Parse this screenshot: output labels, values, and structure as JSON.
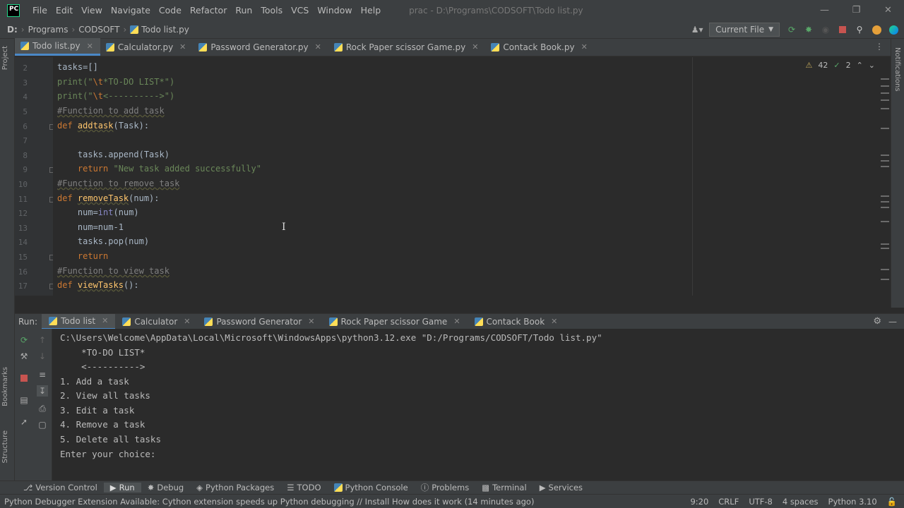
{
  "app": {
    "logo": "PC",
    "window_title": "prac - D:\\Programs\\CODSOFT\\Todo list.py"
  },
  "menu": [
    "File",
    "Edit",
    "View",
    "Navigate",
    "Code",
    "Refactor",
    "Run",
    "Tools",
    "VCS",
    "Window",
    "Help"
  ],
  "breadcrumb": [
    "D:",
    "Programs",
    "CODSOFT",
    "Todo list.py"
  ],
  "run_config": "Current File",
  "editor_tabs": [
    "Todo list.py",
    "Calculator.py",
    "Password Generator.py",
    "Rock Paper scissor Game.py",
    "Contack Book.py"
  ],
  "inspections": {
    "warnings": "42",
    "weak_warnings": "2"
  },
  "side_labels": {
    "project": "Project",
    "notifications": "Notifications",
    "bookmarks": "Bookmarks",
    "structure": "Structure"
  },
  "code_lines": [
    {
      "num": "2"
    },
    {
      "num": "3"
    },
    {
      "num": "4"
    },
    {
      "num": "5"
    },
    {
      "num": "6"
    },
    {
      "num": "7"
    },
    {
      "num": "8"
    },
    {
      "num": "9"
    },
    {
      "num": "10"
    },
    {
      "num": "11"
    },
    {
      "num": "12"
    },
    {
      "num": "13"
    },
    {
      "num": "14"
    },
    {
      "num": "15"
    },
    {
      "num": "16"
    },
    {
      "num": "17"
    }
  ],
  "code": {
    "l2": "tasks=[]",
    "l3_a": "print(\"",
    "l3_esc": "\\t",
    "l3_b": "*TO-DO LIST*\")",
    "l4_a": "print(\"",
    "l4_esc": "\\t",
    "l4_b": "<---------->\")",
    "l5": "#Function to add task",
    "l6_kw": "def ",
    "l6_fn": "addtask",
    "l6_rest": "(Task):",
    "l8": "    tasks.append(Task)",
    "l9_kw": "    return ",
    "l9_str": "\"New task added successfully\"",
    "l10": "#Function to remove task",
    "l11_kw": "def ",
    "l11_fn": "removeTask",
    "l11_rest": "(num):",
    "l12_a": "    num=",
    "l12_bi": "int",
    "l12_b": "(num)",
    "l13": "    num=num-1",
    "l14": "    tasks.pop(num)",
    "l15_kw": "    return",
    "l16": "#Function to view task",
    "l17_kw": "def ",
    "l17_fn": "viewTasks",
    "l17_rest": "():"
  },
  "run_panel": {
    "label": "Run:",
    "tabs": [
      "Todo list",
      "Calculator",
      "Password Generator",
      "Rock Paper scissor Game",
      "Contack Book"
    ]
  },
  "console_lines": [
    "C:\\Users\\Welcome\\AppData\\Local\\Microsoft\\WindowsApps\\python3.12.exe \"D:/Programs/CODSOFT/Todo list.py\"",
    "    *TO-DO LIST*",
    "    <---------->",
    "1. Add a task",
    "2. View all tasks",
    "3. Edit a task",
    "4. Remove a task",
    "5. Delete all tasks",
    "Enter your choice:"
  ],
  "bottom_tools": [
    "Version Control",
    "Run",
    "Debug",
    "Python Packages",
    "TODO",
    "Python Console",
    "Problems",
    "Terminal",
    "Services"
  ],
  "status": {
    "message": "Python Debugger Extension Available: Cython extension speeds up Python debugging // Install   How does it work (14 minutes ago)",
    "position": "9:20",
    "line_sep": "CRLF",
    "encoding": "UTF-8",
    "indent": "4 spaces",
    "interpreter": "Python 3.10"
  }
}
